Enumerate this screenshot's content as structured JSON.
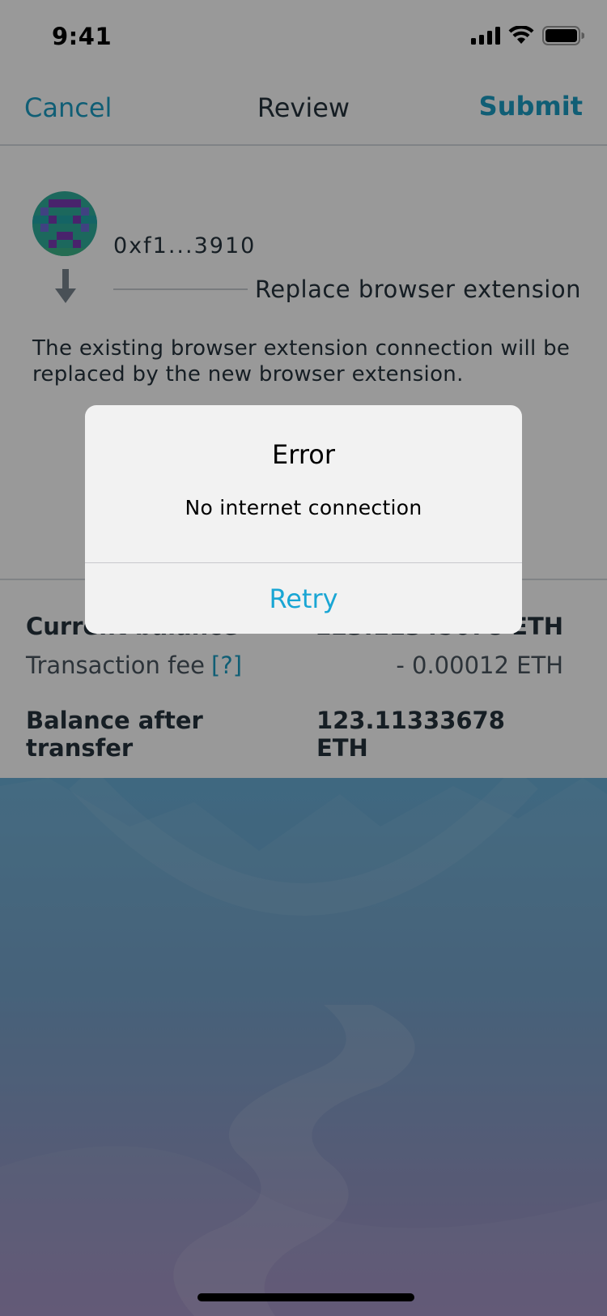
{
  "status_bar": {
    "time": "9:41"
  },
  "nav": {
    "cancel_label": "Cancel",
    "title": "Review",
    "submit_label": "Submit"
  },
  "review": {
    "address": "0xf1...3910",
    "action": "Replace browser extension",
    "description": "The existing browser extension connection will be replaced by the new browser extension."
  },
  "balances": {
    "current_label": "Current balance",
    "current_value": "123.11345678 ETH",
    "fee_label": "Transaction fee",
    "fee_help": "[?]",
    "fee_value": "- 0.00012 ETH",
    "after_label": "Balance after transfer",
    "after_value": "123.11333678 ETH"
  },
  "alert": {
    "title": "Error",
    "message": "No internet connection",
    "button_label": "Retry"
  },
  "colors": {
    "accent": "#1b9dc4",
    "text": "#25323d",
    "alert_background": "#f2f2f2"
  },
  "icons": [
    "signal-icon",
    "wifi-icon",
    "battery-icon",
    "identicon-avatar",
    "arrow-down-icon"
  ]
}
